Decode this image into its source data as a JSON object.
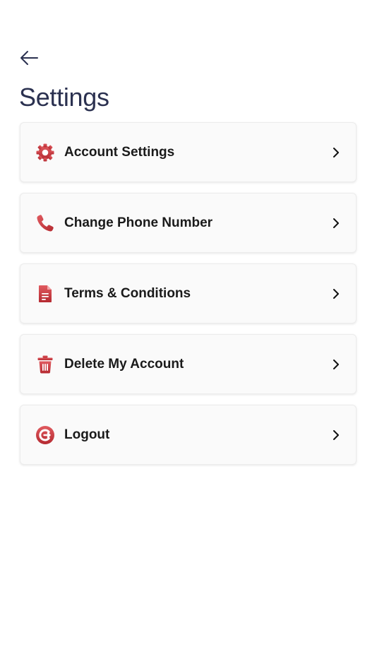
{
  "header": {
    "back_icon": "arrow-left-icon",
    "title": "Settings"
  },
  "colors": {
    "title": "#2b3150",
    "icon_red": "#c8373d",
    "card_bg": "#fafafa",
    "label": "#1a1a1a"
  },
  "menu": {
    "items": [
      {
        "label": "Account Settings",
        "icon": "gear-icon"
      },
      {
        "label": "Change Phone Number",
        "icon": "phone-icon"
      },
      {
        "label": "Terms & Conditions",
        "icon": "document-icon"
      },
      {
        "label": "Delete My Account",
        "icon": "trash-icon"
      },
      {
        "label": "Logout",
        "icon": "logout-icon"
      }
    ],
    "chevron_icon": "chevron-right-icon"
  }
}
